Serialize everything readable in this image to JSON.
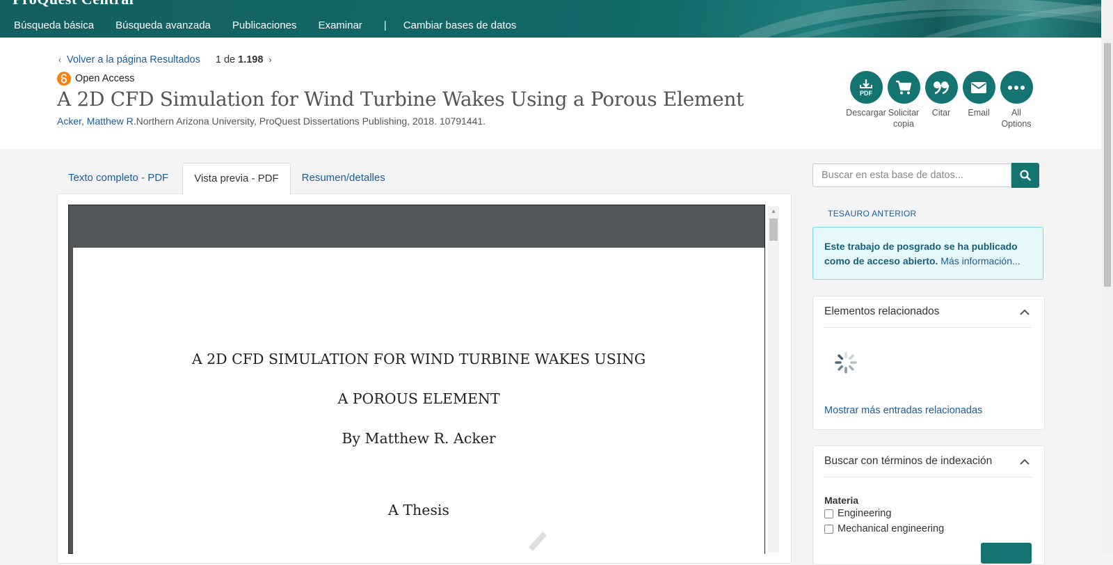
{
  "top_nav": {
    "brand": "ProQuest Central",
    "items": [
      "Búsqueda básica",
      "Búsqueda avanzada",
      "Publicaciones",
      "Examinar"
    ],
    "separator": "|",
    "change_db": "Cambiar bases de datos"
  },
  "header": {
    "back_label": "Volver a la página Resultados",
    "pager_current": "1",
    "pager_of": "de",
    "pager_total": "1.198",
    "open_access": "Open Access",
    "title": "A 2D CFD Simulation for Wind Turbine Wakes Using a Porous Element",
    "author": "Acker, Matthew R.",
    "citation": "Northern Arizona University, ProQuest Dissertations Publishing, 2018. 10791441."
  },
  "actions": [
    {
      "label": "Descargar",
      "icon": "pdf-download-icon",
      "icon_text": "PDF"
    },
    {
      "label": "Solicitar copia",
      "icon": "cart-icon"
    },
    {
      "label": "Citar",
      "icon": "quote-icon"
    },
    {
      "label": "Email",
      "icon": "envelope-icon"
    },
    {
      "label": "All Options",
      "icon": "more-dots-icon"
    }
  ],
  "tabs": [
    "Texto completo - PDF",
    "Vista previa - PDF",
    "Resumen/detalles"
  ],
  "active_tab": "Vista previa - PDF",
  "pdf_page": {
    "lines": [
      "A 2D CFD SIMULATION FOR WIND TURBINE WAKES USING",
      "A POROUS ELEMENT",
      "By Matthew R. Acker",
      "A Thesis"
    ]
  },
  "sidebar": {
    "search_placeholder": "Buscar en esta base de datos...",
    "thesaurus": "TESAURO ANTERIOR",
    "info_strong": "Este trabajo de posgrado se ha publicado como de acceso abierto.",
    "info_link": "Más información...",
    "related": {
      "title": "Elementos relacionados",
      "more": "Mostrar más entradas relacionadas"
    },
    "index_terms": {
      "title": "Buscar con términos de indexación",
      "group": "Materia",
      "options": [
        "Engineering",
        "Mechanical engineering"
      ]
    }
  },
  "colors": {
    "teal": "#137472",
    "link": "#1a5c9c",
    "open_access": "#f68212",
    "info_bg": "#e6f8fc"
  }
}
